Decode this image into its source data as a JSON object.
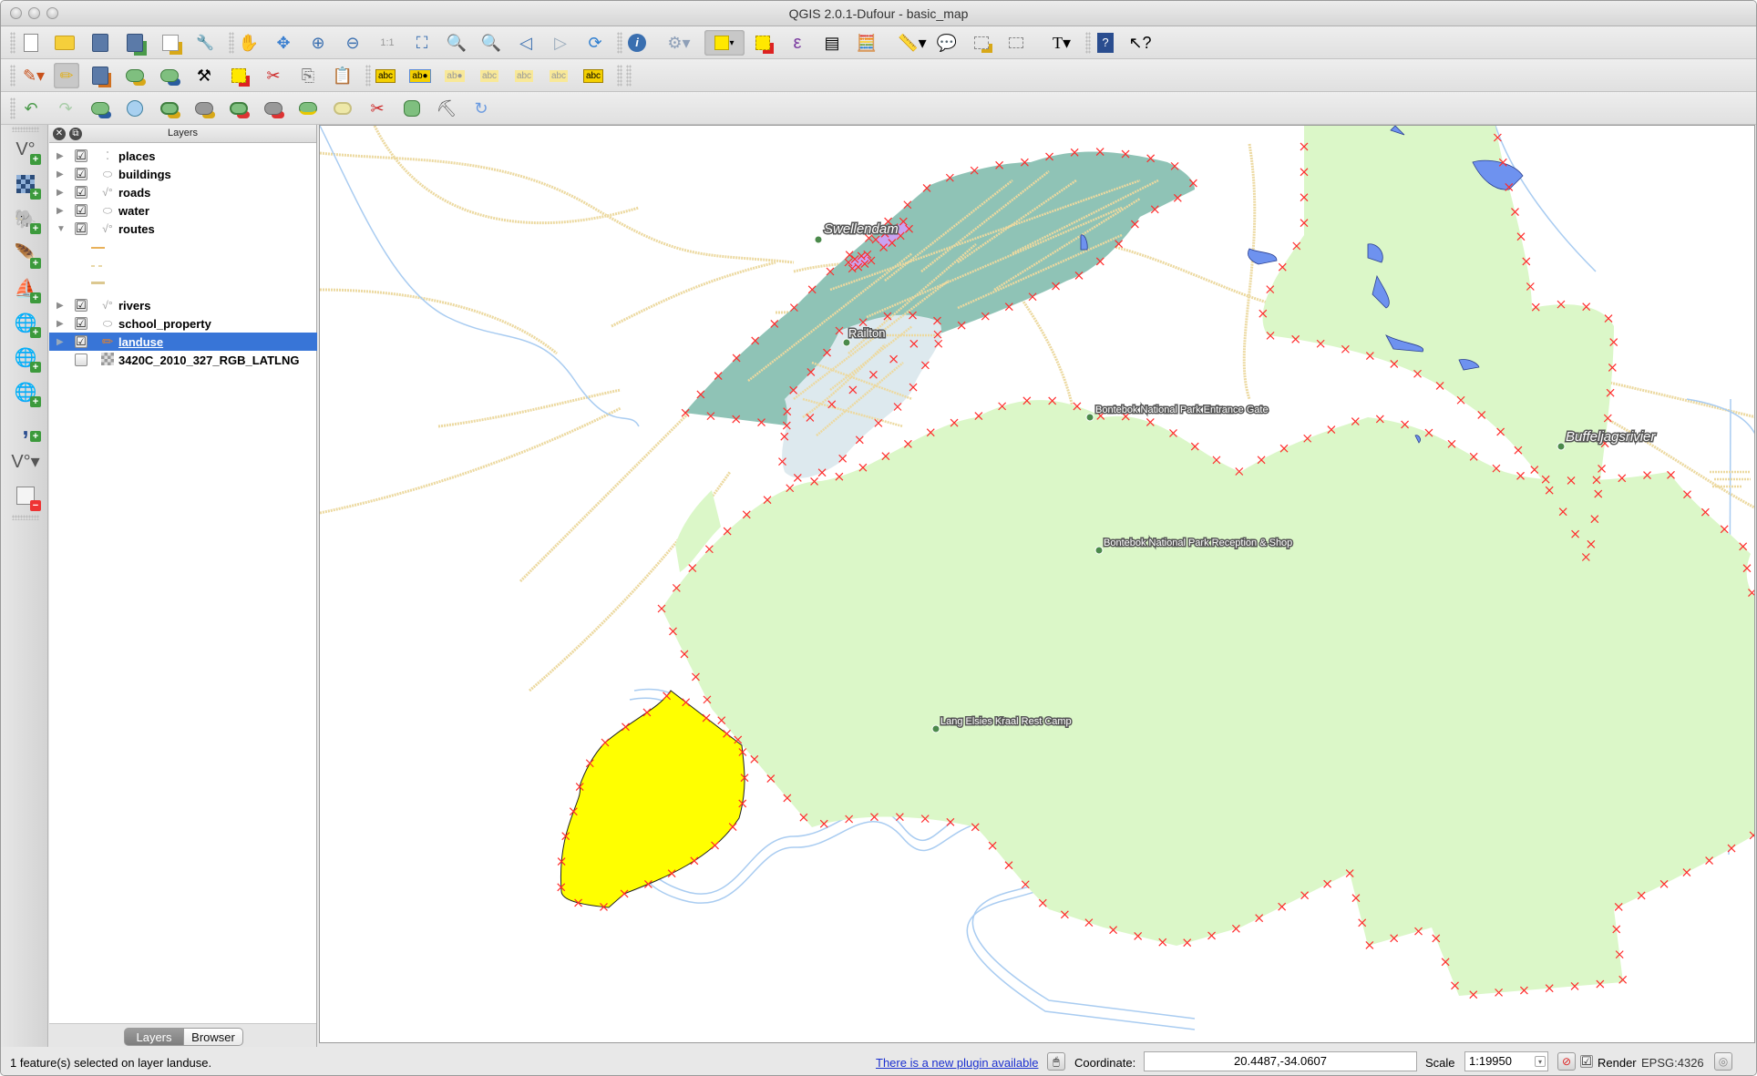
{
  "window": {
    "title": "QGIS 2.0.1-Dufour - basic_map"
  },
  "toolbars": {
    "file": [
      {
        "name": "new-project",
        "icon": "new-file-icon"
      },
      {
        "name": "open-project",
        "icon": "folder-icon"
      },
      {
        "name": "save-project",
        "icon": "save-icon"
      },
      {
        "name": "save-as",
        "icon": "save-as-icon"
      },
      {
        "name": "new-print-composer",
        "icon": "new-composer-icon"
      },
      {
        "name": "composer-manager",
        "icon": "composer-manager-icon"
      }
    ],
    "navigation": [
      {
        "name": "pan",
        "icon": "pan-hand-icon"
      },
      {
        "name": "pan-to-selection",
        "icon": "pan-to-selection-icon"
      },
      {
        "name": "zoom-in",
        "icon": "zoom-in-icon"
      },
      {
        "name": "zoom-out",
        "icon": "zoom-out-icon"
      },
      {
        "name": "zoom-actual",
        "icon": "zoom-actual-size-icon"
      },
      {
        "name": "zoom-full",
        "icon": "zoom-full-icon"
      },
      {
        "name": "zoom-selection",
        "icon": "zoom-selection-icon"
      },
      {
        "name": "zoom-layer",
        "icon": "zoom-layer-icon"
      },
      {
        "name": "zoom-last",
        "icon": "zoom-last-icon"
      },
      {
        "name": "zoom-next",
        "icon": "zoom-next-icon"
      },
      {
        "name": "refresh",
        "icon": "refresh-icon"
      }
    ],
    "attributes": [
      {
        "name": "identify",
        "icon": "identify-icon"
      },
      {
        "name": "run-action",
        "icon": "action-gear-icon"
      },
      {
        "name": "select-features",
        "icon": "select-features-icon",
        "active": true
      },
      {
        "name": "deselect",
        "icon": "deselect-icon"
      },
      {
        "name": "select-by-expression",
        "icon": "select-expression-icon"
      },
      {
        "name": "attribute-table",
        "icon": "attribute-table-icon"
      },
      {
        "name": "field-calculator",
        "icon": "field-calculator-icon"
      },
      {
        "name": "measure",
        "icon": "measure-ruler-icon"
      },
      {
        "name": "map-tips",
        "icon": "map-tips-icon"
      },
      {
        "name": "new-bookmark",
        "icon": "new-bookmark-icon"
      },
      {
        "name": "show-bookmarks",
        "icon": "bookmarks-icon"
      },
      {
        "name": "text-annotation",
        "icon": "text-annotation-icon"
      },
      {
        "name": "help-contents",
        "icon": "help-book-icon"
      },
      {
        "name": "whats-this",
        "icon": "whats-this-icon"
      }
    ],
    "edit_row": [
      {
        "name": "current-edits",
        "icon": "current-edits-icon"
      },
      {
        "name": "toggle-editing",
        "icon": "pencil-icon",
        "active": true
      },
      {
        "name": "save-layer-edits",
        "icon": "save-edits-icon"
      },
      {
        "name": "add-feature",
        "icon": "add-feature-icon"
      },
      {
        "name": "move-feature",
        "icon": "move-feature-icon"
      },
      {
        "name": "node-tool",
        "icon": "node-tool-icon"
      },
      {
        "name": "delete-selected",
        "icon": "delete-selected-icon"
      },
      {
        "name": "cut-features",
        "icon": "scissors-icon"
      },
      {
        "name": "copy-features",
        "icon": "copy-icon"
      },
      {
        "name": "paste-features",
        "icon": "paste-icon"
      },
      {
        "name": "layer-labeling",
        "icon": "label-abc-icon"
      },
      {
        "name": "pin-labels",
        "icon": "pin-label-icon"
      },
      {
        "name": "show-hide-labels",
        "icon": "show-label-icon"
      },
      {
        "name": "show-hide-labels-2",
        "icon": "hide-label-icon"
      },
      {
        "name": "move-label",
        "icon": "move-label-icon"
      },
      {
        "name": "rotate-label",
        "icon": "rotate-label-icon"
      },
      {
        "name": "change-label",
        "icon": "change-label-icon"
      }
    ],
    "advanced_edit_row": [
      {
        "name": "undo",
        "icon": "undo-icon"
      },
      {
        "name": "redo",
        "icon": "redo-icon"
      },
      {
        "name": "rotate-feature",
        "icon": "rotate-feature-icon"
      },
      {
        "name": "simplify-feature",
        "icon": "simplify-icon"
      },
      {
        "name": "add-ring",
        "icon": "add-ring-icon"
      },
      {
        "name": "add-part",
        "icon": "add-part-icon"
      },
      {
        "name": "delete-ring",
        "icon": "delete-ring-icon"
      },
      {
        "name": "delete-part",
        "icon": "delete-part-icon"
      },
      {
        "name": "reshape-features",
        "icon": "reshape-icon"
      },
      {
        "name": "offset-curve",
        "icon": "offset-curve-icon"
      },
      {
        "name": "split-features",
        "icon": "split-features-icon"
      },
      {
        "name": "merge-features",
        "icon": "merge-features-icon"
      },
      {
        "name": "merge-attributes",
        "icon": "merge-attributes-icon"
      },
      {
        "name": "rotate-point-symbols",
        "icon": "rotate-symbols-icon"
      }
    ]
  },
  "left_toolbar": [
    {
      "name": "add-vector-layer",
      "icon": "vector-layer-icon"
    },
    {
      "name": "add-raster-layer",
      "icon": "raster-layer-icon"
    },
    {
      "name": "add-postgis-layer",
      "icon": "postgis-elephant-icon"
    },
    {
      "name": "add-spatialite-layer",
      "icon": "spatialite-feather-icon"
    },
    {
      "name": "add-mssql-layer",
      "icon": "mssql-icon"
    },
    {
      "name": "add-wms-layer",
      "icon": "wms-globe-icon"
    },
    {
      "name": "add-wcs-layer",
      "icon": "wcs-globe-icon"
    },
    {
      "name": "add-wfs-layer",
      "icon": "wfs-globe-icon"
    },
    {
      "name": "add-delimited-text-layer",
      "icon": "delimited-text-icon"
    },
    {
      "name": "new-shapefile-layer",
      "icon": "new-shapefile-icon"
    },
    {
      "name": "remove-layer",
      "icon": "remove-layer-icon"
    }
  ],
  "layers_panel": {
    "title": "Layers",
    "layers": [
      {
        "name": "places",
        "type": "point",
        "checked": "☑",
        "expanded": false,
        "selected": false
      },
      {
        "name": "buildings",
        "type": "polygon",
        "checked": "☑",
        "expanded": false,
        "selected": false
      },
      {
        "name": "roads",
        "type": "line",
        "checked": "☑",
        "expanded": false,
        "selected": false
      },
      {
        "name": "water",
        "type": "polygon",
        "checked": "☑",
        "expanded": false,
        "selected": false
      },
      {
        "name": "routes",
        "type": "line",
        "checked": "☑",
        "expanded": true,
        "selected": false
      },
      {
        "name": "rivers",
        "type": "line",
        "checked": "☑",
        "expanded": false,
        "selected": false
      },
      {
        "name": "school_property",
        "type": "polygon",
        "checked": "☑",
        "expanded": false,
        "selected": false
      },
      {
        "name": "landuse",
        "type": "editing",
        "checked": "☑",
        "expanded": false,
        "selected": true
      },
      {
        "name": "3420C_2010_327_RGB_LATLNG",
        "type": "raster",
        "checked": "",
        "expanded": false,
        "selected": false
      }
    ],
    "routes_legend_colors": [
      "#e9b15a",
      "#e8d8a8",
      "#dcc890"
    ],
    "tabs": [
      "Layers",
      "Browser"
    ],
    "active_tab": "Layers"
  },
  "map": {
    "labels": {
      "swellendam": "Swellendam",
      "railton": "Railton",
      "entrance_gate": "Bontebok National Park Entrance Gate",
      "reception": "Bontebok National Park Reception & Shop",
      "rest_camp": "Lang Elsies Kraal Rest Camp",
      "buffeljagsrivier": "Buffeljagsrivier"
    },
    "colors": {
      "town_fill": "#8fc3b6",
      "suburb_fill": "#dde9ee",
      "park_fill": "#dbf7c8",
      "selected_fill": "#ffff00",
      "road": "#ecd9a0",
      "river": "#a9ccf1",
      "water": "#6e92ef",
      "vertex_marker": "#ff2b2b",
      "place_point": "#4b8a4b",
      "school": "#c9a3f1"
    }
  },
  "statusbar": {
    "message": "1 feature(s) selected on layer landuse.",
    "plugin_link": "There is a new plugin available",
    "coordinate_label": "Coordinate:",
    "coordinate_value": "20.4487,-34.0607",
    "scale_label": "Scale",
    "scale_value": "1:19950",
    "render_label": "Render",
    "render_checked": "☑",
    "crs": "EPSG:4326"
  }
}
